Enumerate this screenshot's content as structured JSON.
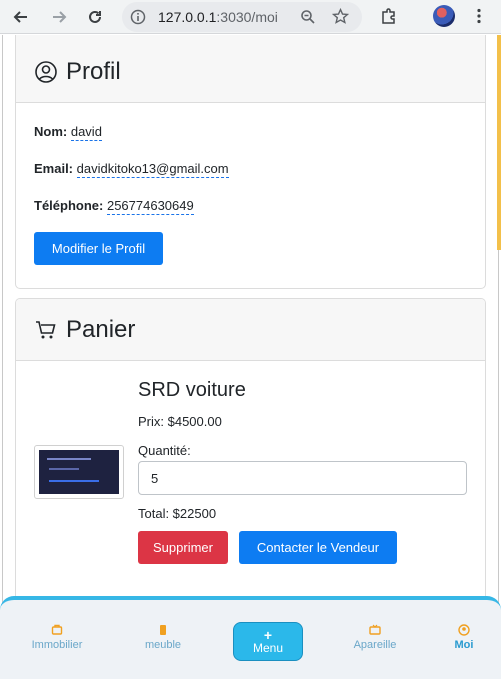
{
  "browser": {
    "url_host": "127.0.0.1",
    "url_rest": ":3030/moi"
  },
  "profile": {
    "title": "Profil",
    "name_label": "Nom:",
    "name_value": "david",
    "email_label": "Email:",
    "email_value": "davidkitoko13@gmail.com",
    "phone_label": "Téléphone:",
    "phone_value": "256774630649",
    "edit_button": "Modifier le Profil"
  },
  "cart": {
    "title": "Panier",
    "product_name": "SRD voiture",
    "price": "Prix: $4500.00",
    "quantity_label": "Quantité:",
    "quantity_value": "5",
    "total": "Total: $22500",
    "delete_button": "Supprimer",
    "contact_button": "Contacter le Vendeur"
  },
  "bottom_nav": {
    "items": [
      {
        "label": "Immobilier",
        "icon": "building-icon"
      },
      {
        "label": "meuble",
        "icon": "furniture-icon"
      },
      {
        "label": "Menu",
        "icon": "plus-icon"
      },
      {
        "label": "Apareille",
        "icon": "tv-icon"
      },
      {
        "label": "Moi",
        "icon": "user-icon"
      }
    ]
  },
  "colors": {
    "primary": "#0d7cf2",
    "danger": "#dc3545",
    "nav_accent": "#36b7e6"
  }
}
